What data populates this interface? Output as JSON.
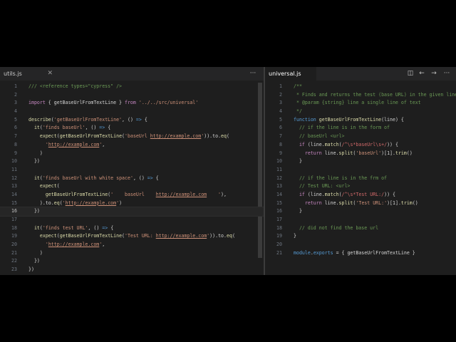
{
  "left_pane": {
    "tab_label": "utils.js",
    "more_icon": "more-icon",
    "lines": [
      {
        "n": "1",
        "t": "/// <reference types=\"cypress\" />"
      },
      {
        "n": "2",
        "t": ""
      },
      {
        "n": "3",
        "t": "import { getBaseUrlFromTextLine } from '../../src/universal'"
      },
      {
        "n": "4",
        "t": ""
      },
      {
        "n": "5",
        "t": "describe('getBaseUrlFromTextLine', () => {"
      },
      {
        "n": "6",
        "t": "  it('finds baseUrl', () => {"
      },
      {
        "n": "7",
        "t": "    expect(getBaseUrlFromTextLine('baseUrl http://example.com')).to.eq("
      },
      {
        "n": "8",
        "t": "      'http://example.com',"
      },
      {
        "n": "9",
        "t": "    )"
      },
      {
        "n": "10",
        "t": "  })"
      },
      {
        "n": "11",
        "t": ""
      },
      {
        "n": "12",
        "t": "  it('finds baseUrl with white space', () => {"
      },
      {
        "n": "13",
        "t": "    expect("
      },
      {
        "n": "14",
        "t": "      getBaseUrlFromTextLine('    baseUrl    http://example.com    '),"
      },
      {
        "n": "15",
        "t": "    ).to.eq('http://example.com')"
      },
      {
        "n": "16",
        "t": "  })"
      },
      {
        "n": "17",
        "t": ""
      },
      {
        "n": "18",
        "t": "  it('finds test URL', () => {"
      },
      {
        "n": "19",
        "t": "    expect(getBaseUrlFromTextLine('Test URL: http://example.com')).to.eq("
      },
      {
        "n": "20",
        "t": "      'http://example.com',"
      },
      {
        "n": "21",
        "t": "    )"
      },
      {
        "n": "22",
        "t": "  })"
      },
      {
        "n": "23",
        "t": "})"
      }
    ]
  },
  "right_pane": {
    "tab_label": "universal.js",
    "icons": [
      "split-editor-icon",
      "go-back-icon",
      "go-forward-icon",
      "more-icon"
    ],
    "lines": [
      {
        "n": "1",
        "t": "/**"
      },
      {
        "n": "2",
        "t": " * Finds and returns the test (base URL) in the given line"
      },
      {
        "n": "3",
        "t": " * @param {string} line a single line of text"
      },
      {
        "n": "4",
        "t": " */"
      },
      {
        "n": "5",
        "t": "function getBaseUrlFromTextLine(line) {"
      },
      {
        "n": "6",
        "t": "  // if the line is in the form of"
      },
      {
        "n": "7",
        "t": "  // baseUrl <url>"
      },
      {
        "n": "8",
        "t": "  if (line.match(/^\\s*baseUrl\\s+/)) {"
      },
      {
        "n": "9",
        "t": "    return line.split('baseUrl')[1].trim()"
      },
      {
        "n": "10",
        "t": "  }"
      },
      {
        "n": "11",
        "t": ""
      },
      {
        "n": "12",
        "t": "  // if the line is in the frm of"
      },
      {
        "n": "13",
        "t": "  // Test URL: <url>"
      },
      {
        "n": "14",
        "t": "  if (line.match(/^\\s*Test URL:/)) {"
      },
      {
        "n": "15",
        "t": "    return line.split('Test URL:')[1].trim()"
      },
      {
        "n": "16",
        "t": "  }"
      },
      {
        "n": "17",
        "t": ""
      },
      {
        "n": "18",
        "t": "  // did not find the base url"
      },
      {
        "n": "19",
        "t": "}"
      },
      {
        "n": "20",
        "t": ""
      },
      {
        "n": "21",
        "t": "module.exports = { getBaseUrlFromTextLine }"
      }
    ]
  },
  "current_line_left": "16",
  "colors": {
    "editor_bg": "#1e1e1e",
    "tab_bg": "#252526",
    "string": "#ce9178",
    "keyword": "#569cd6",
    "comment": "#6a9955",
    "function": "#dcdcaa"
  }
}
